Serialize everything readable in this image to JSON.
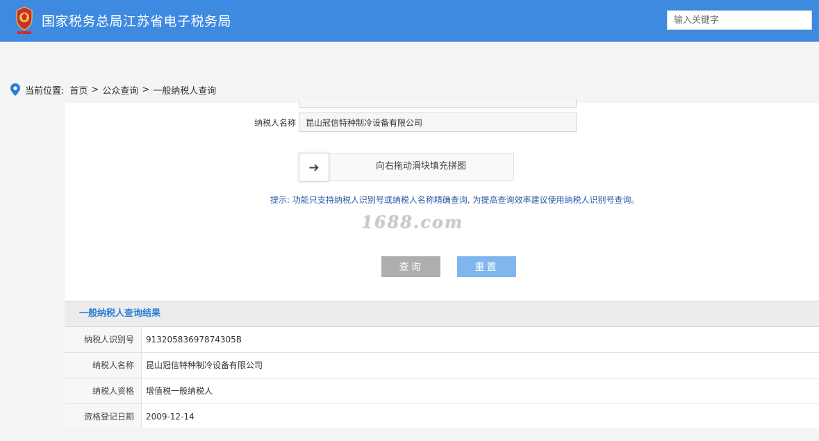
{
  "header": {
    "site_title": "国家税务总局江苏省电子税务局",
    "search_placeholder": "输入关键字",
    "brand_color": "#3d8ae0"
  },
  "breadcrumb": {
    "label": "当前位置:",
    "items": [
      "首页",
      "公众查询",
      "一般纳税人查询"
    ],
    "separator": ">"
  },
  "form": {
    "name_label": "纳税人名称",
    "name_value": "昆山冠信特种制冷设备有限公司",
    "slider_text": "向右拖动滑块填充拼图",
    "slider_icon": "arrow-right-icon",
    "hint": "提示: 功能只支持纳税人识别号或纳税人名称精确查询, 为提高查询效率建议使用纳税人识别号查询。",
    "watermark": "1688.com",
    "query_label": "查询",
    "reset_label": "重置"
  },
  "result": {
    "title": "一般纳税人查询结果",
    "rows": [
      {
        "key": "纳税人识别号",
        "value": "91320583697874305B"
      },
      {
        "key": "纳税人名称",
        "value": "昆山冠信特种制冷设备有限公司"
      },
      {
        "key": "纳税人资格",
        "value": "增值税一般纳税人"
      },
      {
        "key": "资格登记日期",
        "value": "2009-12-14"
      }
    ]
  }
}
